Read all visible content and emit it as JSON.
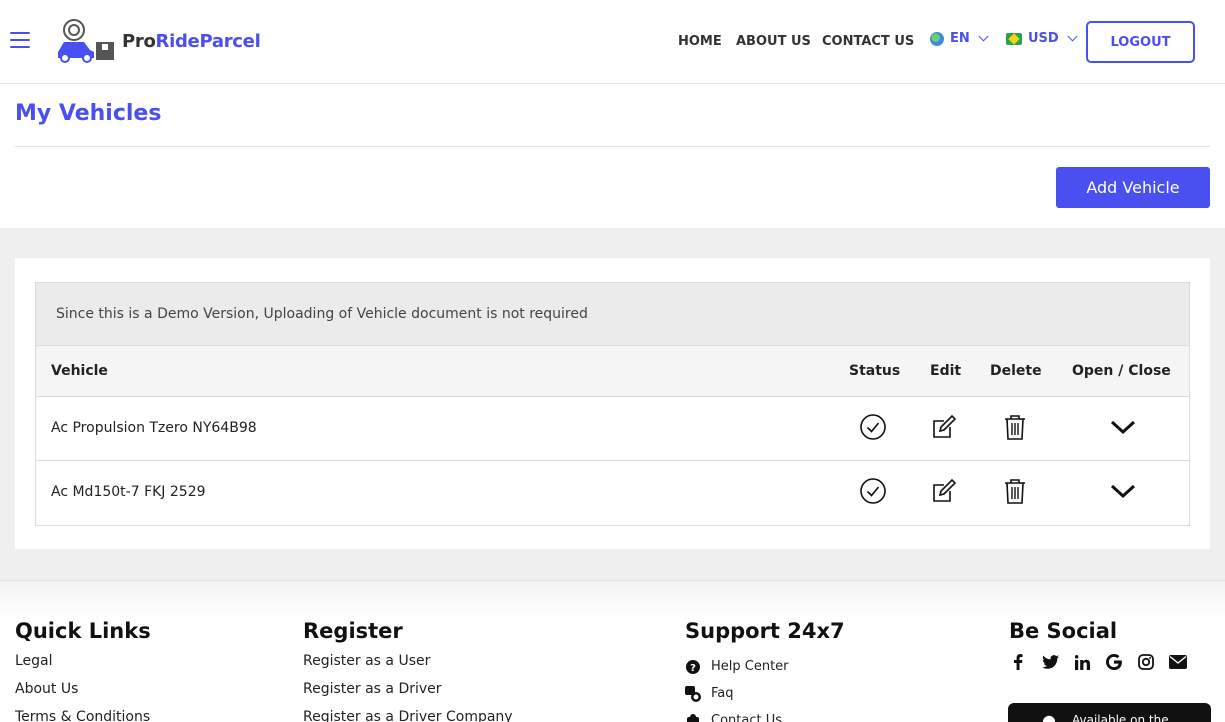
{
  "brand": {
    "prefix": "Pro",
    "suffix": "RideParcel"
  },
  "nav": {
    "home": "HOME",
    "about": "ABOUT US",
    "contact": "CONTACT US"
  },
  "language": {
    "label": "EN"
  },
  "currency": {
    "label": "USD"
  },
  "logout": "LOGOUT",
  "page": {
    "title": "My Vehicles",
    "add_button": "Add Vehicle"
  },
  "notice": "Since this is a Demo Version, Uploading of Vehicle document is not required",
  "table": {
    "headers": {
      "vehicle": "Vehicle",
      "status": "Status",
      "edit": "Edit",
      "delete": "Delete",
      "open_close": "Open / Close"
    },
    "rows": [
      {
        "vehicle": "Ac Propulsion Tzero NY64B98"
      },
      {
        "vehicle": "Ac Md150t-7 FKJ 2529"
      }
    ]
  },
  "footer": {
    "quick_links": {
      "title": "Quick Links",
      "items": [
        "Legal",
        "About Us",
        "Terms & Conditions"
      ]
    },
    "register": {
      "title": "Register",
      "items": [
        "Register as a User",
        "Register as a Driver",
        "Register as a Driver Company"
      ]
    },
    "support": {
      "title": "Support 24x7",
      "items": [
        "Help Center",
        "Faq",
        "Contact Us"
      ]
    },
    "social": {
      "title": "Be Social",
      "icons": [
        "facebook-icon",
        "twitter-icon",
        "linkedin-icon",
        "google-icon",
        "instagram-icon",
        "email-icon"
      ]
    },
    "appstore": "Available on the"
  },
  "colors": {
    "accent": "#4a4ff0",
    "grey_bg": "#efefef"
  }
}
